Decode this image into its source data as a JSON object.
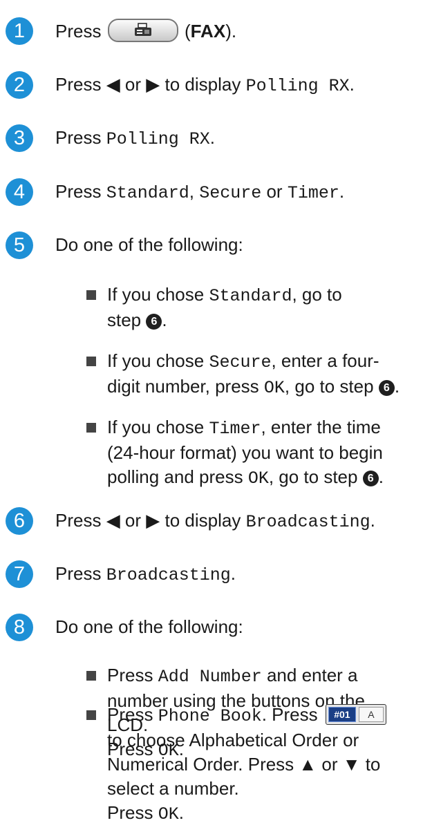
{
  "steps": [
    {
      "n": "1",
      "press": "Press",
      "fax_label": "FAX",
      "open": "(",
      "close": ")."
    },
    {
      "n": "2",
      "a": "Press",
      "arrows": "◀ or ▶",
      "b": "to display",
      "m": "Polling RX",
      "end": "."
    },
    {
      "n": "3",
      "a": "Press",
      "m": "Polling RX",
      "end": "."
    },
    {
      "n": "4",
      "a": "Press",
      "m1": "Standard",
      "c1": ",",
      "m2": "Secure",
      "or": "or",
      "m3": "Timer",
      "end": "."
    },
    {
      "n": "5",
      "a": "Do one of the following:"
    },
    {
      "n": "6",
      "a": "Press",
      "arrows": "◀ or ▶",
      "b": "to display",
      "m": "Broadcasting",
      "end": "."
    },
    {
      "n": "7",
      "a": "Press",
      "m": "Broadcasting",
      "end": "."
    },
    {
      "n": "8",
      "a": "Do one of the following:"
    }
  ],
  "step5_bullets": [
    {
      "l1a": "If you chose",
      "l1m": "Standard",
      "l1b": ", go to",
      "l2a": "step",
      "circ": "6",
      "l2b": "."
    },
    {
      "l1a": "If you chose",
      "l1m": "Secure",
      "l1b": ", enter a four-",
      "l2a": "digit number, press",
      "l2m": "OK",
      "l2b": ", go to step",
      "circ": "6",
      "l2c": "."
    },
    {
      "l1a": "If you chose",
      "l1m": "Timer",
      "l1b": ", enter the time",
      "l2a": "(24-hour format) you want to begin",
      "l3a": "polling and press",
      "l3m": "OK",
      "l3b": ", go to step",
      "circ": "6",
      "l3c": "."
    }
  ],
  "step8_bullets": [
    {
      "l1a": "Press",
      "l1m": "Add Number",
      "l1b": "and enter a",
      "l2a": "number using the buttons on the",
      "l3a": "LCD.",
      "l4a": "Press",
      "l4m": "OK",
      "l4b": "."
    },
    {
      "l1a": "Press",
      "l1m": "Phone Book",
      "l1b": ". Press",
      "lcd_dark": "#01",
      "lcd_light": "A",
      "l2a": "to choose Alphabetical Order or",
      "l3a": "Numerical Order. Press",
      "l3arrows": "▲ or ▼",
      "l3b": "to",
      "l4a": "select a number.",
      "l5a": "Press",
      "l5m": "OK",
      "l5b": "."
    }
  ],
  "icons": {
    "fax": "fax-icon",
    "bullet": "square-bullet-icon",
    "step_badge": "step-number-badge"
  },
  "colors": {
    "step_badge": "#1e90d6",
    "text": "#1a1a1a"
  }
}
